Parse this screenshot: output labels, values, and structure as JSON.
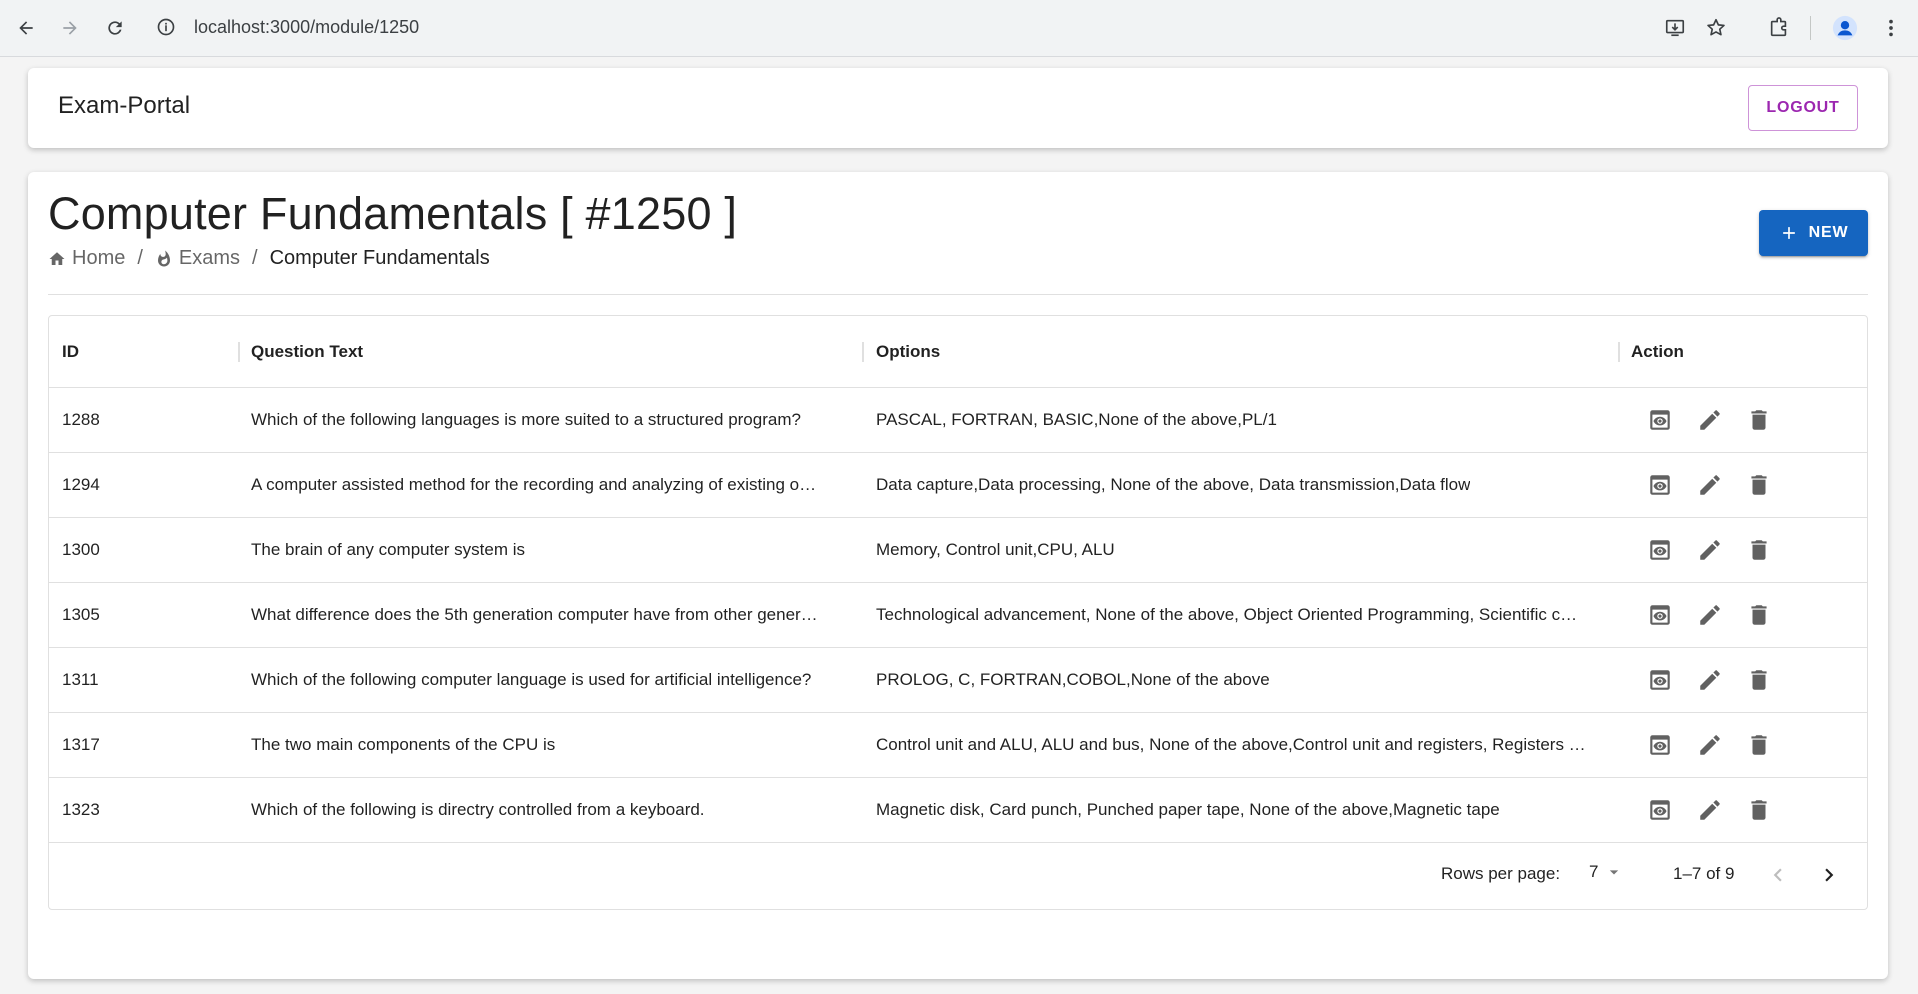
{
  "browser": {
    "url": "localhost:3000/module/1250",
    "icons": [
      "back-arrow-icon",
      "forward-arrow-icon",
      "reload-icon",
      "site-info-icon",
      "install-app-icon",
      "bookmark-star-icon",
      "extensions-icon",
      "profile-icon",
      "menu-dots-icon"
    ]
  },
  "appbar": {
    "brand": "Exam-Portal",
    "logout_label": "LOGOUT"
  },
  "page": {
    "title": "Computer Fundamentals [ #1250 ]",
    "new_label": "NEW",
    "breadcrumb": {
      "home": "Home",
      "sep1": "/",
      "exams": "Exams",
      "sep2": "/",
      "current": "Computer Fundamentals"
    }
  },
  "table": {
    "columns": [
      "ID",
      "Question Text",
      "Options",
      "Action"
    ],
    "rows": [
      {
        "id": "1288",
        "question": "Which of the following languages is more suited to a structured program?",
        "options": "PASCAL, FORTRAN, BASIC,None of the above,PL/1"
      },
      {
        "id": "1294",
        "question": "A computer assisted method for the recording and analyzing of existing o…",
        "options": "Data capture,Data processing, None of the above, Data transmission,Data flow"
      },
      {
        "id": "1300",
        "question": "The brain of any computer system is",
        "options": "Memory, Control unit,CPU, ALU"
      },
      {
        "id": "1305",
        "question": "What difference does the 5th generation computer have from other gener…",
        "options": "Technological advancement, None of the above, Object Oriented Programming, Scientific c…"
      },
      {
        "id": "1311",
        "question": "Which of the following computer language is used for artificial intelligence?",
        "options": "PROLOG, C, FORTRAN,COBOL,None of the above"
      },
      {
        "id": "1317",
        "question": "The two main components of the CPU is",
        "options": "Control unit and ALU, ALU and bus, None of the above,Control unit and registers, Registers …"
      },
      {
        "id": "1323",
        "question": "Which of the following is directry controlled from a keyboard.",
        "options": "Magnetic disk, Card punch, Punched paper tape, None of the above,Magnetic tape"
      }
    ],
    "action_icons": [
      "preview-icon",
      "edit-pencil-icon",
      "delete-trash-icon"
    ]
  },
  "pagination": {
    "rows_per_page_label": "Rows per page:",
    "rows_per_page": "7",
    "range": "1–7 of 9"
  },
  "colors": {
    "primary": "#1565c0",
    "logout": "#9c27b0"
  }
}
